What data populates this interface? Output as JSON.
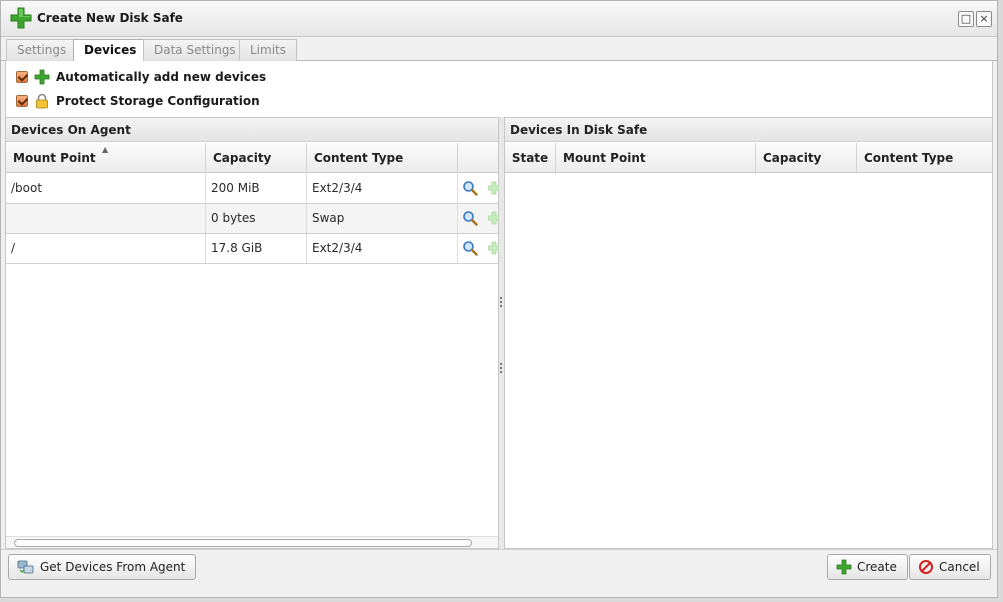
{
  "window": {
    "title": "Create New Disk Safe",
    "maximize_glyph": "□",
    "close_glyph": "×"
  },
  "tabs": [
    {
      "label": "Settings",
      "active": false
    },
    {
      "label": "Devices",
      "active": true
    },
    {
      "label": "Data Settings",
      "active": false
    },
    {
      "label": "Limits",
      "active": false
    }
  ],
  "options": [
    {
      "label": "Automatically add new devices",
      "checked": true,
      "icon": "plus-icon"
    },
    {
      "label": "Protect Storage Configuration",
      "checked": true,
      "icon": "lock-icon"
    }
  ],
  "left_panel": {
    "title": "Devices On Agent",
    "columns": [
      "Mount Point",
      "Capacity",
      "Content Type"
    ],
    "sort_indicator": "▲",
    "rows": [
      {
        "mount_point": "/boot",
        "capacity": "200 MiB",
        "content_type": "Ext2/3/4"
      },
      {
        "mount_point": "",
        "capacity": "0 bytes",
        "content_type": "Swap"
      },
      {
        "mount_point": "/",
        "capacity": "17.8 GiB",
        "content_type": "Ext2/3/4"
      }
    ]
  },
  "right_panel": {
    "title": "Devices In Disk Safe",
    "columns": [
      "State",
      "Mount Point",
      "Capacity",
      "Content Type"
    ],
    "rows": []
  },
  "footer": {
    "get_devices_label": "Get Devices From Agent",
    "create_label": "Create",
    "cancel_label": "Cancel"
  },
  "colors": {
    "accent_green": "#3da62e",
    "checkbox_orange": "#e07a3b",
    "cancel_red": "#d42121"
  }
}
